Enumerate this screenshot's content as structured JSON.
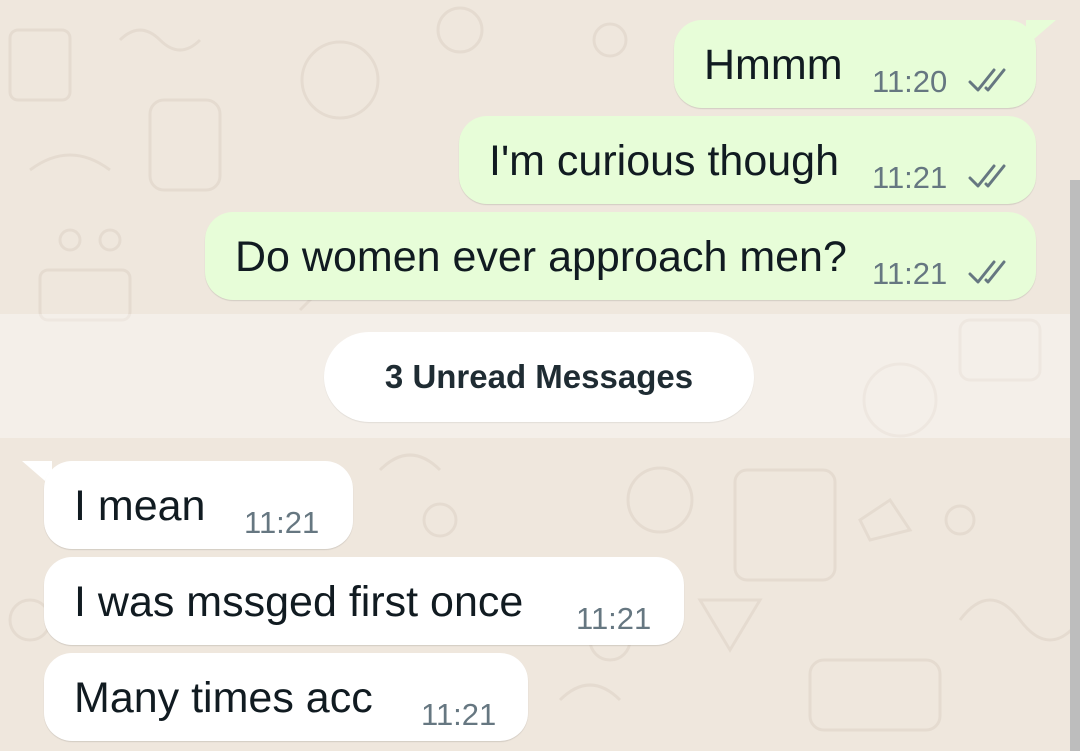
{
  "colors": {
    "background": "#efe7dd",
    "outgoing_bubble": "#e7fdd8",
    "incoming_bubble": "#ffffff",
    "text": "#111b21",
    "timestamp": "#667781",
    "ticks": "#667781"
  },
  "outgoing_messages": [
    {
      "text": "Hmmm",
      "time": "11:20",
      "status_icon": "double-check-icon"
    },
    {
      "text": "I'm curious though",
      "time": "11:21",
      "status_icon": "double-check-icon"
    },
    {
      "text": "Do women ever approach men?",
      "time": "11:21",
      "status_icon": "double-check-icon"
    }
  ],
  "unread_divider": {
    "label": "3 Unread Messages"
  },
  "incoming_messages": [
    {
      "text": "I mean",
      "time": "11:21"
    },
    {
      "text": "I was mssged first once",
      "time": "11:21"
    },
    {
      "text": "Many times acc",
      "time": "11:21"
    }
  ]
}
